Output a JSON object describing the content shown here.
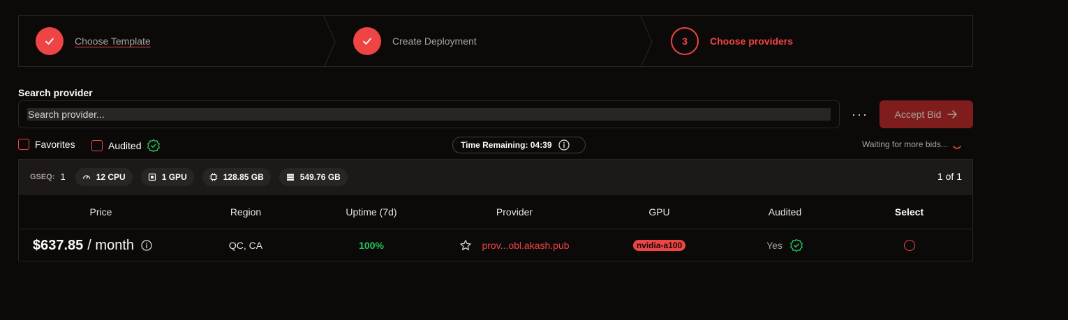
{
  "stepper": {
    "steps": [
      {
        "label": "Choose Template",
        "state": "done"
      },
      {
        "label": "Create Deployment",
        "state": "done"
      },
      {
        "label": "Choose providers",
        "state": "current",
        "number": "3"
      }
    ]
  },
  "search": {
    "title": "Search provider",
    "placeholder": "Search provider..."
  },
  "actions": {
    "more": "···",
    "accept_label": "Accept Bid"
  },
  "filters": {
    "favorites": "Favorites",
    "audited": "Audited"
  },
  "timer": {
    "text": "Time Remaining: 04:39"
  },
  "status": {
    "waiting": "Waiting for more bids..."
  },
  "group": {
    "gseq_label": "GSEQ:",
    "gseq_value": "1",
    "resources": {
      "cpu": "12 CPU",
      "gpu": "1 GPU",
      "memory": "128.85 GB",
      "storage": "549.76 GB"
    },
    "pager": "1 of 1"
  },
  "table": {
    "columns": {
      "price": "Price",
      "region": "Region",
      "uptime": "Uptime (7d)",
      "provider": "Provider",
      "gpu": "GPU",
      "audited": "Audited",
      "select": "Select"
    },
    "rows": [
      {
        "price": "$637.85",
        "price_unit": "/ month",
        "region": "QC, CA",
        "uptime": "100%",
        "provider": "prov...obl.akash.pub",
        "gpu": "nvidia-a100",
        "audited": "Yes"
      }
    ]
  },
  "colors": {
    "accent": "#ef4444",
    "success": "#22c55e",
    "background": "#0c0a09",
    "border": "#292524"
  }
}
